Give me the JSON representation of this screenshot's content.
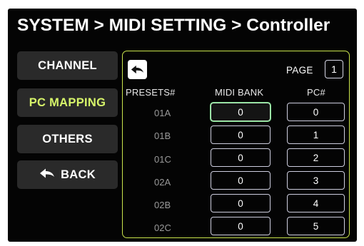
{
  "header": {
    "title": "SYSTEM  >  MIDI SETTING > Controller"
  },
  "sidebar": {
    "items": [
      {
        "label": "CHANNEL"
      },
      {
        "label": "PC MAPPING"
      },
      {
        "label": "OTHERS"
      },
      {
        "label": "BACK"
      }
    ]
  },
  "panel": {
    "page_label": "PAGE",
    "page_value": "1",
    "columns": {
      "presets": "PRESETS#",
      "midi_bank": "MIDI BANK",
      "pc": "PC#"
    },
    "rows": [
      {
        "preset": "01A",
        "midi_bank": "0",
        "pc": "0"
      },
      {
        "preset": "01B",
        "midi_bank": "0",
        "pc": "1"
      },
      {
        "preset": "01C",
        "midi_bank": "0",
        "pc": "2"
      },
      {
        "preset": "02A",
        "midi_bank": "0",
        "pc": "3"
      },
      {
        "preset": "02B",
        "midi_bank": "0",
        "pc": "4"
      },
      {
        "preset": "02C",
        "midi_bank": "0",
        "pc": "5"
      }
    ]
  },
  "colors": {
    "accent": "#d7f56a",
    "panel_border": "#c9e44c",
    "background": "#040404"
  }
}
